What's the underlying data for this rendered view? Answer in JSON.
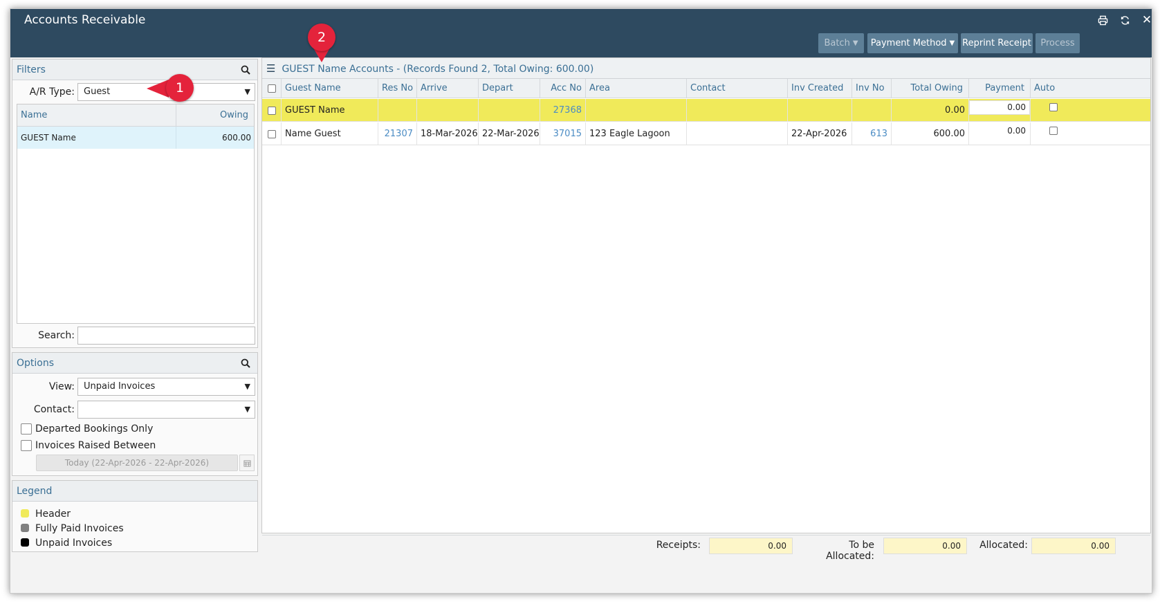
{
  "window": {
    "title": "Accounts Receivable",
    "icons": [
      "print-icon",
      "refresh-icon",
      "close-icon"
    ],
    "close_glyph": "✕",
    "toolbar": {
      "batch_label": "Batch",
      "payment_method_label": "Payment Method",
      "reprint_receipt_label": "Reprint Receipt",
      "process_label": "Process"
    }
  },
  "filters": {
    "title": "Filters",
    "ar_type_label": "A/R Type:",
    "ar_type_value": "Guest",
    "list": {
      "columns": [
        "Name",
        "Owing"
      ],
      "rows": [
        {
          "name": "GUEST Name",
          "owing": "600.00"
        }
      ]
    },
    "search_label": "Search:",
    "search_value": ""
  },
  "options": {
    "title": "Options",
    "view_label": "View:",
    "view_value": "Unpaid Invoices",
    "contact_label": "Contact:",
    "contact_value": "",
    "departed_only_label": "Departed Bookings Only",
    "invoices_raised_label": "Invoices Raised Between",
    "date_range": "Today (22-Apr-2026 - 22-Apr-2026)"
  },
  "legend": {
    "title": "Legend",
    "items": [
      {
        "label": "Header",
        "color": "#f0ea5a"
      },
      {
        "label": "Fully Paid Invoices",
        "color": "#808080"
      },
      {
        "label": "Unpaid Invoices",
        "color": "#000000"
      }
    ]
  },
  "grid": {
    "title": "GUEST Name Accounts - (Records Found 2, Total Owing: 600.00)",
    "columns": [
      "Guest Name",
      "Res No",
      "Arrive",
      "Depart",
      "Acc No",
      "Area",
      "Contact",
      "Inv Created",
      "Inv No",
      "Total Owing",
      "Payment",
      "Auto"
    ],
    "rows": [
      {
        "guest_name": "GUEST Name",
        "res_no": "",
        "arrive": "",
        "depart": "",
        "acc_no": "27368",
        "area": "",
        "contact": "",
        "inv_created": "",
        "inv_no": "",
        "total_owing": "0.00",
        "payment": "0.00",
        "is_header": true
      },
      {
        "guest_name": "Name Guest",
        "res_no": "21307",
        "arrive": "18-Mar-2026",
        "depart": "22-Mar-2026",
        "acc_no": "37015",
        "area": "123 Eagle Lagoon",
        "contact": "",
        "inv_created": "22-Apr-2026",
        "inv_no": "613",
        "total_owing": "600.00",
        "payment": "0.00",
        "is_header": false
      }
    ],
    "header_row_color": "#f0ea5a"
  },
  "footer": {
    "receipts_label": "Receipts:",
    "receipts_value": "0.00",
    "to_be_allocated_label": "To be Allocated:",
    "to_be_allocated_value": "0.00",
    "allocated_label": "Allocated:",
    "allocated_value": "0.00"
  },
  "callouts": [
    "1",
    "2"
  ]
}
